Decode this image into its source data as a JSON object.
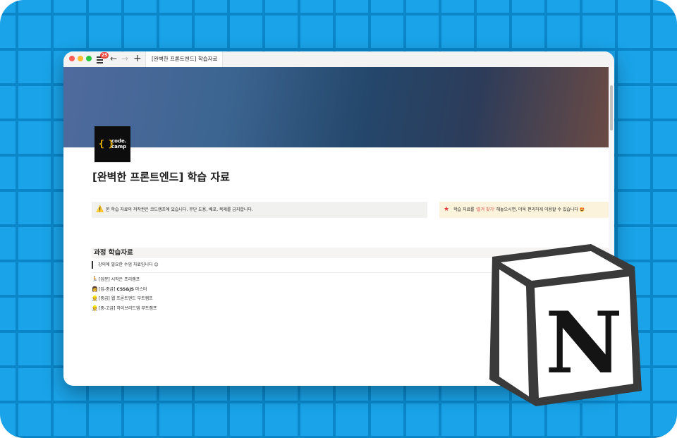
{
  "browser": {
    "tab_count": "25",
    "back_glyph": "←",
    "forward_glyph": "→",
    "new_tab_glyph": "+",
    "tab_title": "[완벽한 프론트엔드] 학습자료"
  },
  "page": {
    "logo_line1": "code.",
    "logo_line2": "camp",
    "logo_brace": "{ }",
    "title": "[완벽한 프론트엔드] 학습 자료",
    "callouts": [
      {
        "icon": "⚠️",
        "text": "본 학습 자료의 저작권은 코드캠프에 있습니다. 무단 도용, 배포, 복제를 금지합니다."
      },
      {
        "icon": "★",
        "text_before": "학습 자료를 ",
        "highlight": "'즐겨 찾기'",
        "text_after": " 해놓으시면, 더욱 편리하게 이용할 수 있습니다 🤩"
      }
    ],
    "section_title": "과정 학습자료",
    "quote": "강의에 필요한 수업 자료입니다 😊",
    "links": [
      {
        "emoji": "🏃",
        "prefix": "[입문] ",
        "bold": "",
        "suffix": "시작은 프리캠프"
      },
      {
        "emoji": "👩",
        "prefix": "[입-중급] ",
        "bold": "CSS&JS",
        "suffix": " 마스터"
      },
      {
        "emoji": "👷",
        "prefix": "[중급] ",
        "bold": "",
        "suffix": "웹 프론트엔드 부트캠프"
      },
      {
        "emoji": "👷",
        "prefix": "[중-고급] ",
        "bold": "",
        "suffix": "하이브리드앱 부트캠프"
      }
    ]
  },
  "overlay": {
    "notion_letter": "N"
  },
  "colors": {
    "background_blue": "#1aa3e8",
    "grid_line": "#0a86c9",
    "logo_brace": "#f5b800",
    "highlight_red": "#d44c47"
  }
}
